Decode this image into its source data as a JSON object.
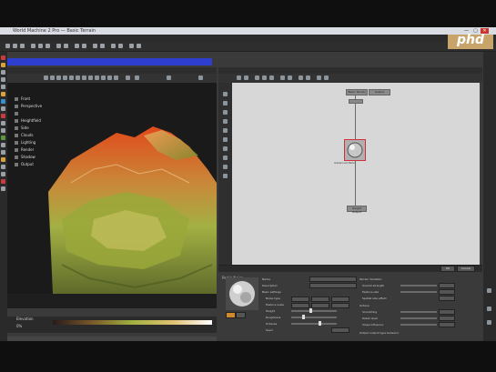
{
  "window": {
    "title": "World Machine 2 Pro — Basic Terrain",
    "minimize": "—",
    "maximize": "▢",
    "close": "✕"
  },
  "menu": [
    "File",
    "Edit",
    "View",
    "Workflow",
    "Device",
    "Generator",
    "Filter",
    "Natural",
    "Output",
    "Help"
  ],
  "brand": {
    "logo_text": "phd",
    "accent": "#c8a46a"
  },
  "colors": {
    "selection_blue": "#2e3fd0",
    "node_select": "#d0303a",
    "terrain_high": "#e04a1b",
    "terrain_mid": "#a3b043",
    "terrain_low": "#5e6a2a"
  },
  "viewport": {
    "header_label": "3D Preview",
    "blue_bar_label": "Preview",
    "layers": [
      "Front",
      "Perspective",
      "",
      "Heightfield",
      "Side",
      "Clouds",
      "Lighting",
      "Render",
      "Shadow",
      "Output",
      "",
      ""
    ],
    "bottom_label": "Elevation",
    "bottom_label2": "0%"
  },
  "graph": {
    "header_label": "Device Workview",
    "nodes": {
      "top": "Basic Terrain",
      "top_label2": "Output",
      "middle": "Advanced Perlin",
      "bottom": "Height Output"
    }
  },
  "props": {
    "header_label": "Perlin Noise",
    "name_label": "Name",
    "desc_label": "Description",
    "section_basic": "Basic settings",
    "rows": [
      {
        "label": "Noise type"
      },
      {
        "label": "Feature scale"
      },
      {
        "label": "Height"
      },
      {
        "label": "Roughness"
      },
      {
        "label": "Octaves"
      },
      {
        "label": "Seed"
      }
    ],
    "right": {
      "section1": "Terrain Variation",
      "row1": "Overall strength",
      "row2": "Feature size",
      "row3": "Spatial size effect",
      "section2": "Octave",
      "row4": "Smoothing",
      "row5": "Detail level",
      "row6": "Slope influence",
      "section3": "Output output-type behavior",
      "row7": "Height range",
      "row8": "Level",
      "section4": "Self-output Output range mode",
      "row9": "Clamp"
    },
    "buttons": {
      "ok": "OK",
      "cancel": "Cancel"
    }
  }
}
